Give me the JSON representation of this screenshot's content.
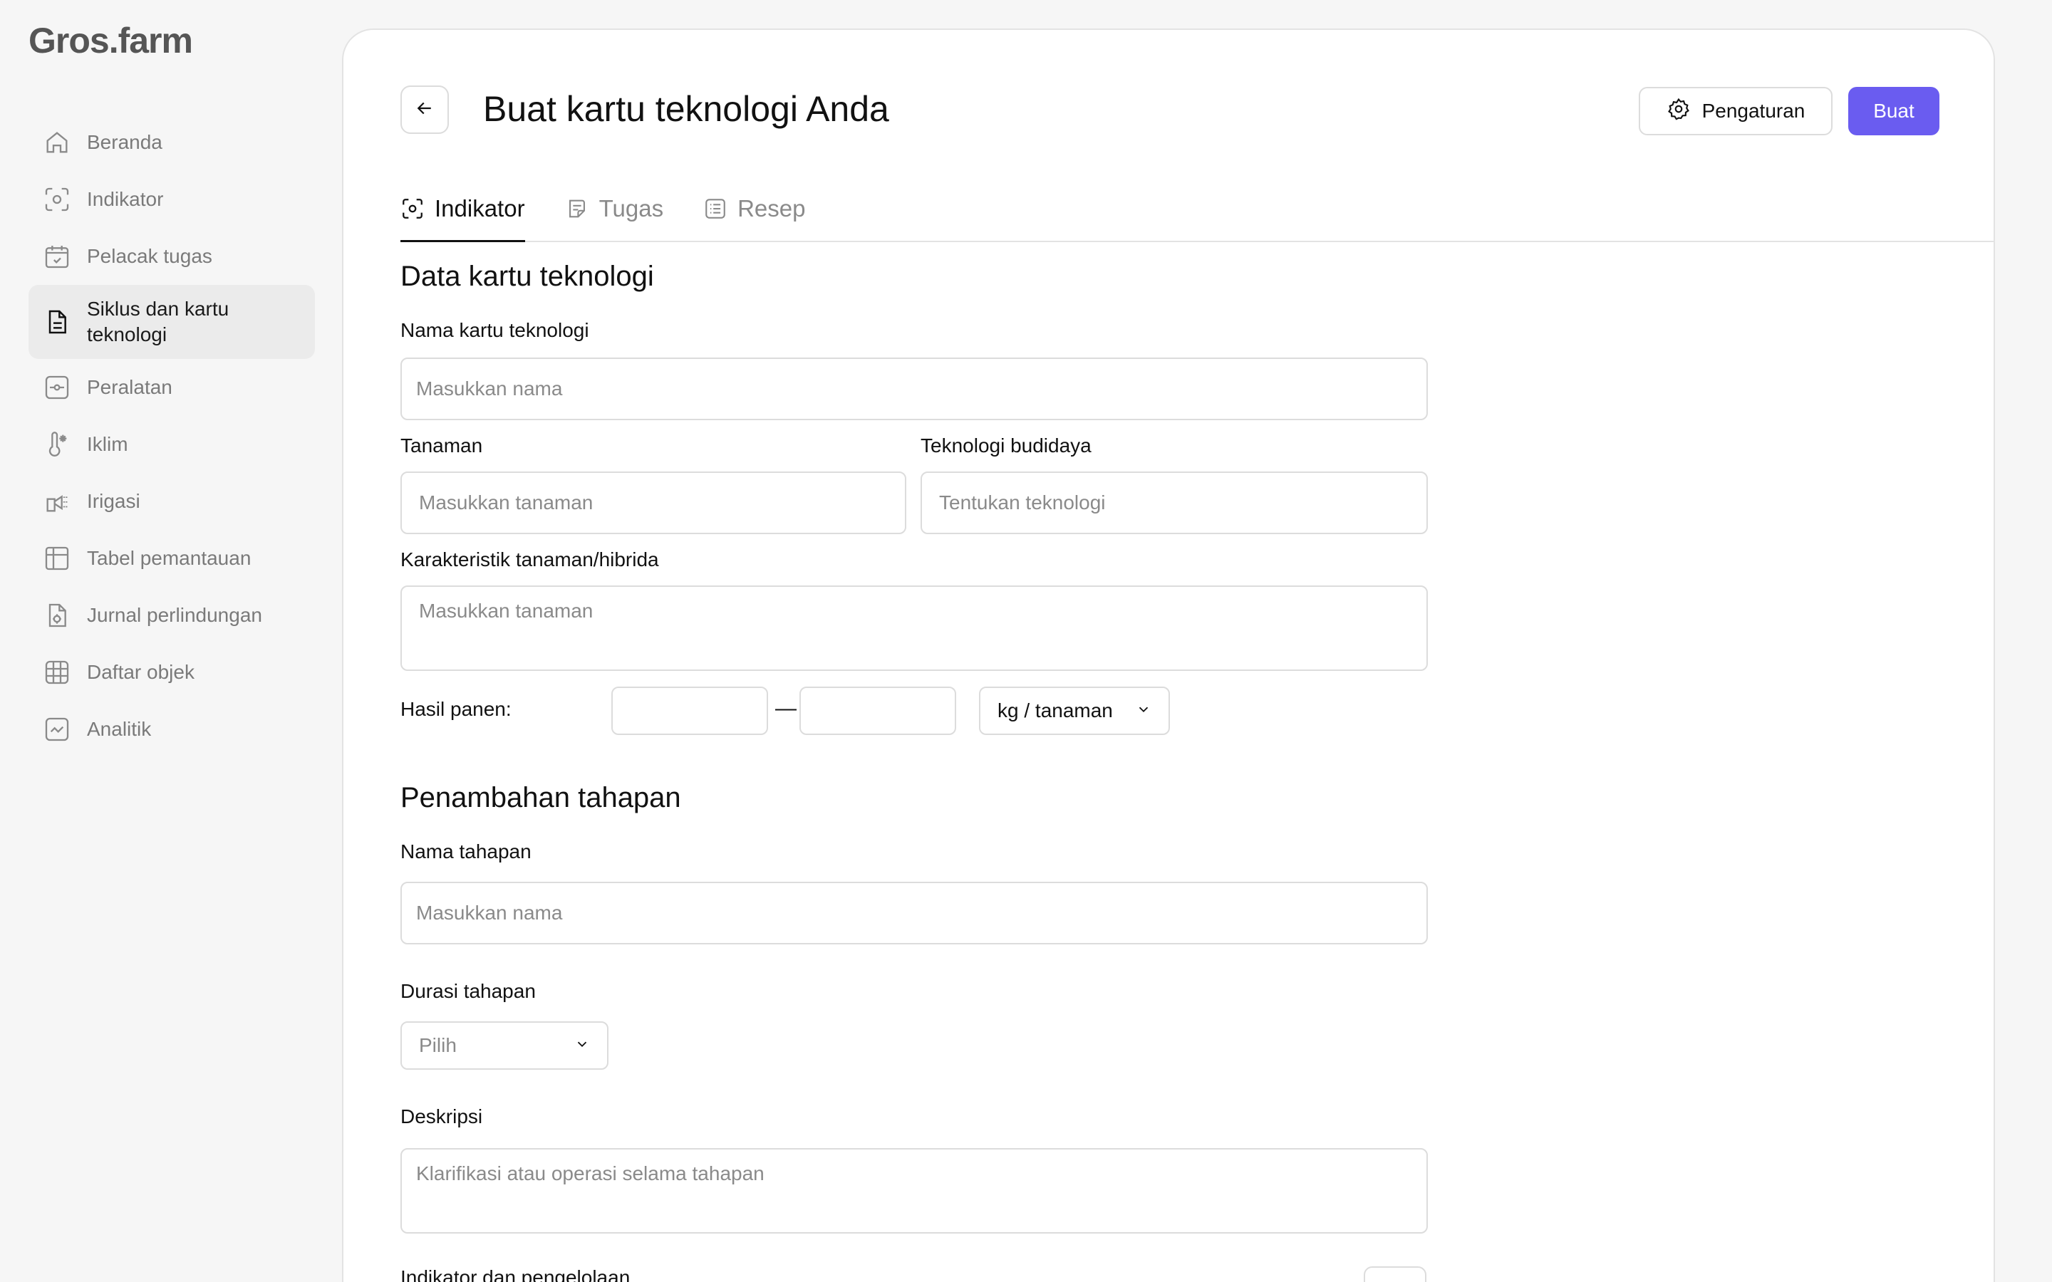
{
  "app": {
    "logo": "Gros.farm"
  },
  "sidebar": {
    "items": [
      {
        "label": "Beranda",
        "icon": "home-icon"
      },
      {
        "label": "Indikator",
        "icon": "indicator-icon"
      },
      {
        "label": "Pelacak tugas",
        "icon": "calendar-check-icon"
      },
      {
        "label": "Siklus dan kartu teknologi",
        "icon": "document-icon",
        "active": true
      },
      {
        "label": "Peralatan",
        "icon": "equipment-icon"
      },
      {
        "label": "Iklim",
        "icon": "thermometer-icon"
      },
      {
        "label": "Irigasi",
        "icon": "irrigation-icon"
      },
      {
        "label": "Tabel pemantauan",
        "icon": "table-icon"
      },
      {
        "label": "Jurnal perlindungan",
        "icon": "protection-journal-icon"
      },
      {
        "label": "Daftar objek",
        "icon": "grid-icon"
      },
      {
        "label": "Analitik",
        "icon": "analytics-icon"
      }
    ]
  },
  "header": {
    "title": "Buat kartu teknologi Anda",
    "settings_label": "Pengaturan",
    "create_label": "Buat"
  },
  "tabs": [
    {
      "label": "Indikator",
      "active": true
    },
    {
      "label": "Tugas"
    },
    {
      "label": "Resep"
    }
  ],
  "form": {
    "section1_title": "Data kartu teknologi",
    "name_label": "Nama kartu teknologi",
    "name_placeholder": "Masukkan nama",
    "plant_label": "Tanaman",
    "plant_placeholder": "Masukkan tanaman",
    "tech_label": "Teknologi budidaya",
    "tech_placeholder": "Tentukan teknologi",
    "char_label": "Karakteristik tanaman/hibrida",
    "char_placeholder": "Masukkan tanaman",
    "yield_label": "Hasil panen:",
    "yield_from": "",
    "yield_to": "",
    "yield_separator": "—",
    "yield_unit": "kg / tanaman",
    "section2_title": "Penambahan tahapan",
    "stage_name_label": "Nama tahapan",
    "stage_name_placeholder": "Masukkan nama",
    "stage_duration_label": "Durasi tahapan",
    "stage_duration_value": "Pilih",
    "description_label": "Deskripsi",
    "description_placeholder": "Klarifikasi atau operasi selama tahapan",
    "indicators_label": "Indikator dan pengelolaan"
  },
  "colors": {
    "accent": "#6a5cf0",
    "border": "#dcdcdc",
    "muted": "#8a8a8a"
  }
}
